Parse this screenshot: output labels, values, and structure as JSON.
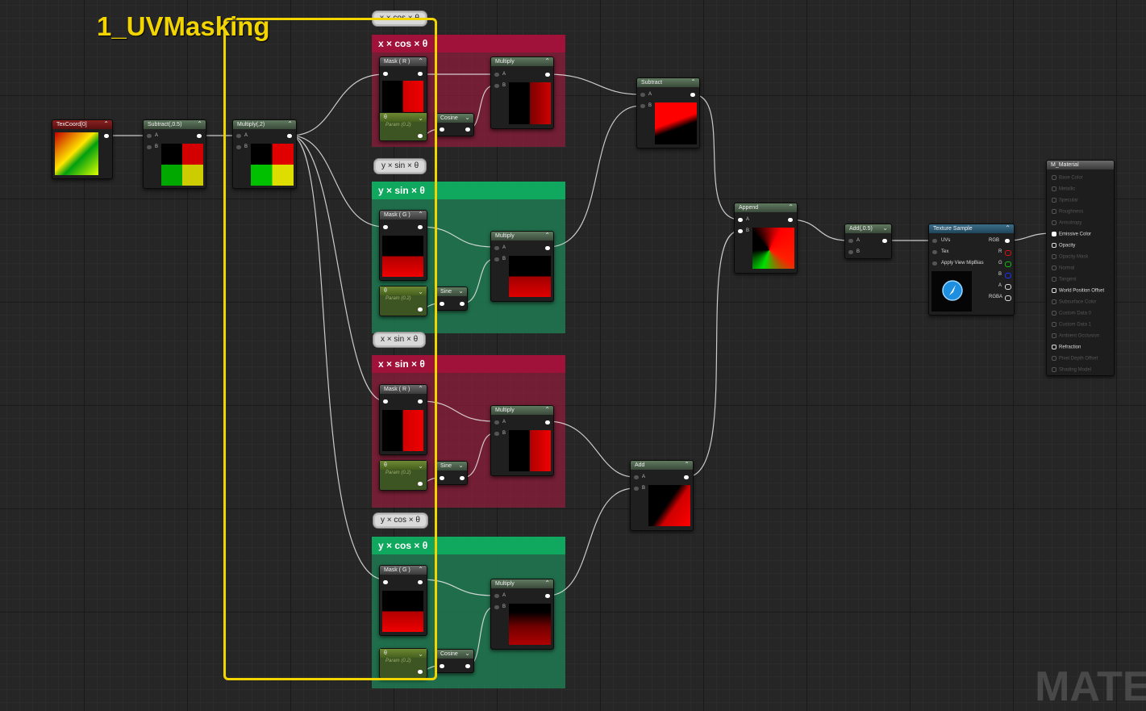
{
  "section_label": "1_UVMasking",
  "watermark": "MATEI",
  "comments": {
    "c1": {
      "title": "x × cos × θ",
      "bubble": "x × cos × θ",
      "color": "#8c1c3a"
    },
    "c2": {
      "title": "y × sin × θ",
      "bubble": "y × sin × θ",
      "color": "#1e7a52"
    },
    "c3": {
      "title": "x × sin × θ",
      "bubble": "x × sin × θ",
      "color": "#8c1c3a"
    },
    "c4": {
      "title": "y × cos × θ",
      "bubble": "y × cos × θ",
      "color": "#1e7a52"
    }
  },
  "nodes": {
    "texcoord": {
      "title": "TexCoord[0]"
    },
    "subtract_half": {
      "title": "Subtract(,0.5)",
      "pin_a": "A",
      "pin_b": "B"
    },
    "multiply_two": {
      "title": "Multiply(,2)",
      "pin_a": "A",
      "pin_b": "B"
    },
    "mask_r1": {
      "title": "Mask ( R )"
    },
    "mask_g1": {
      "title": "Mask ( G )"
    },
    "mask_r2": {
      "title": "Mask ( R )"
    },
    "mask_g2": {
      "title": "Mask ( G )"
    },
    "theta1": {
      "title": "θ",
      "sub": "Param (0.2)"
    },
    "theta2": {
      "title": "θ",
      "sub": "Param (0.2)"
    },
    "theta3": {
      "title": "θ",
      "sub": "Param (0.2)"
    },
    "theta4": {
      "title": "θ",
      "sub": "Param (0.2)"
    },
    "cosine1": {
      "title": "Cosine"
    },
    "sine1": {
      "title": "Sine"
    },
    "sine2": {
      "title": "Sine"
    },
    "cosine2": {
      "title": "Cosine"
    },
    "mul1": {
      "title": "Multiply",
      "pin_a": "A",
      "pin_b": "B"
    },
    "mul2": {
      "title": "Multiply",
      "pin_a": "A",
      "pin_b": "B"
    },
    "mul3": {
      "title": "Multiply",
      "pin_a": "A",
      "pin_b": "B"
    },
    "mul4": {
      "title": "Multiply",
      "pin_a": "A",
      "pin_b": "B"
    },
    "subtract": {
      "title": "Subtract",
      "pin_a": "A",
      "pin_b": "B"
    },
    "add": {
      "title": "Add",
      "pin_a": "A",
      "pin_b": "B"
    },
    "append": {
      "title": "Append",
      "pin_a": "A",
      "pin_b": "B"
    },
    "add_half": {
      "title": "Add(,0.5)",
      "pin_a": "A",
      "pin_b": "B"
    },
    "texsample": {
      "title": "Texture Sample",
      "inputs": [
        "UVs",
        "Tex",
        "Apply View MipBias"
      ],
      "outputs": [
        "RGB",
        "R",
        "G",
        "B",
        "A",
        "RGBA"
      ]
    },
    "material": {
      "title": "M_Material",
      "pins": [
        "Base Color",
        "Metallic",
        "Specular",
        "Roughness",
        "Anisotropy",
        "Emissive Color",
        "Opacity",
        "Opacity Mask",
        "Normal",
        "Tangent",
        "World Position Offset",
        "Subsurface Color",
        "Custom Data 0",
        "Custom Data 1",
        "Ambient Occlusion",
        "Refraction",
        "Pixel Depth Offset",
        "Shading Model"
      ]
    }
  }
}
